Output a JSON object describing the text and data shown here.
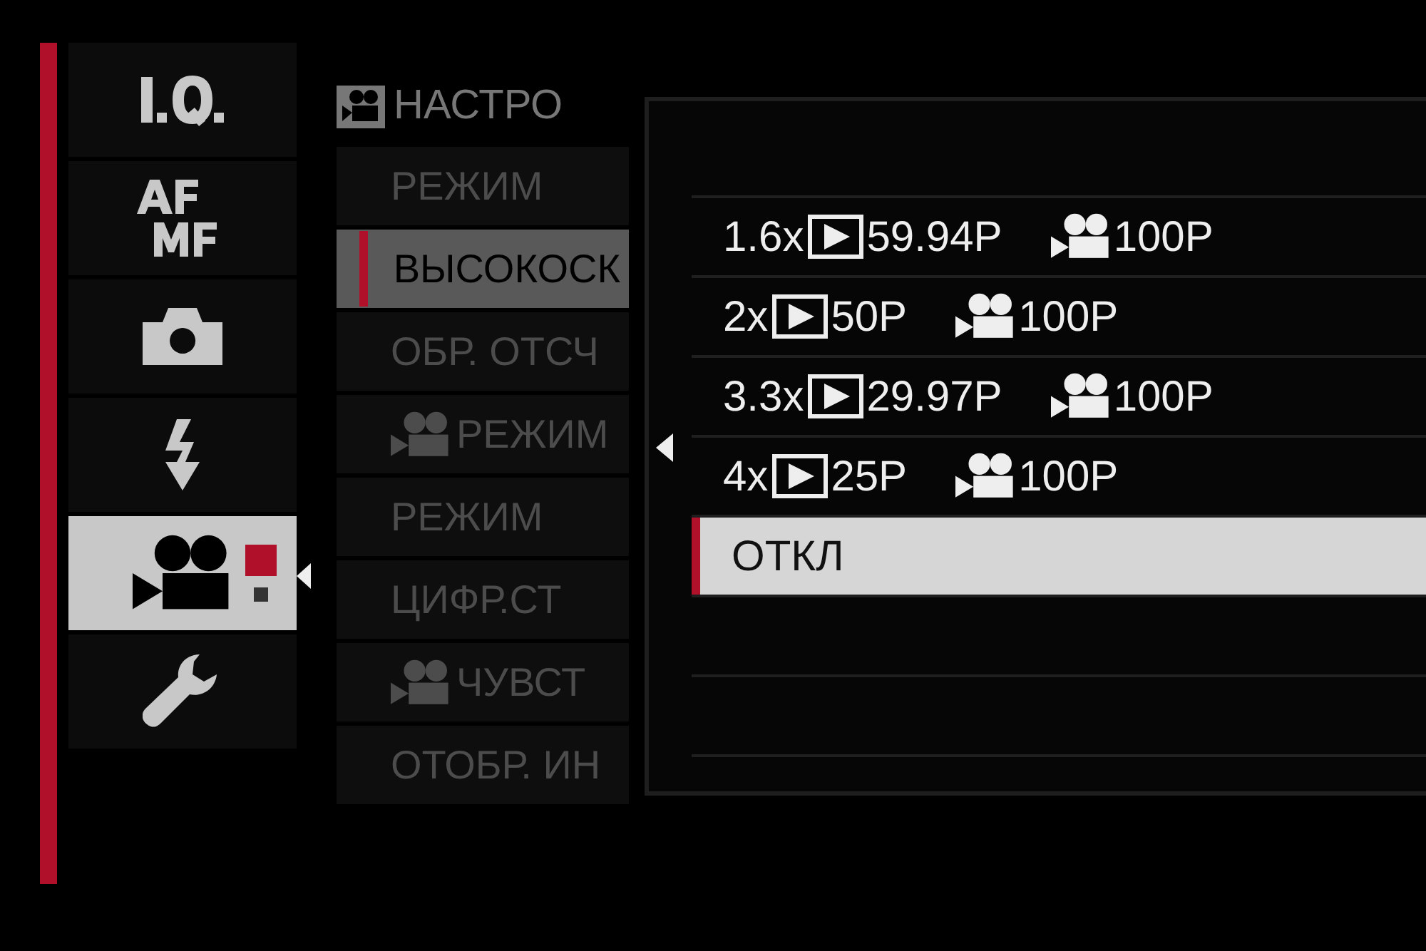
{
  "tabs": [
    {
      "kind": "iq",
      "selected": false
    },
    {
      "kind": "afmf",
      "selected": false
    },
    {
      "kind": "camera",
      "selected": false
    },
    {
      "kind": "flash",
      "selected": false
    },
    {
      "kind": "movie",
      "selected": true
    },
    {
      "kind": "wrench",
      "selected": false
    }
  ],
  "tab_pages": [
    {
      "selected": true
    },
    {
      "selected": false
    }
  ],
  "menu": {
    "title": "НАСТРО",
    "items": [
      {
        "label": "РЕЖИМ",
        "movie_icon": false,
        "selected": false
      },
      {
        "label": "ВЫСОКОСК",
        "movie_icon": false,
        "selected": true
      },
      {
        "label": "ОБР. ОТСЧ",
        "movie_icon": false,
        "selected": false
      },
      {
        "label": "РЕЖИМ",
        "movie_icon": true,
        "selected": false
      },
      {
        "label": "РЕЖИМ",
        "movie_icon": false,
        "selected": false
      },
      {
        "label": "ЦИФР.СТ",
        "movie_icon": false,
        "selected": false
      },
      {
        "label": "ЧУВСТ",
        "movie_icon": true,
        "selected": false
      },
      {
        "label": "ОТОБР. ИН",
        "movie_icon": false,
        "selected": false
      }
    ]
  },
  "popup": {
    "options": [
      {
        "kind": "rate",
        "factor": "1.6x",
        "playback": "59.94P",
        "record": "100P",
        "selected": false
      },
      {
        "kind": "rate",
        "factor": "2x",
        "playback": "50P",
        "record": "100P",
        "selected": false
      },
      {
        "kind": "rate",
        "factor": "3.3x",
        "playback": "29.97P",
        "record": "100P",
        "selected": false
      },
      {
        "kind": "rate",
        "factor": "4x",
        "playback": "25P",
        "record": "100P",
        "selected": false
      },
      {
        "kind": "text",
        "label": "ОТКЛ",
        "selected": true
      }
    ]
  }
}
